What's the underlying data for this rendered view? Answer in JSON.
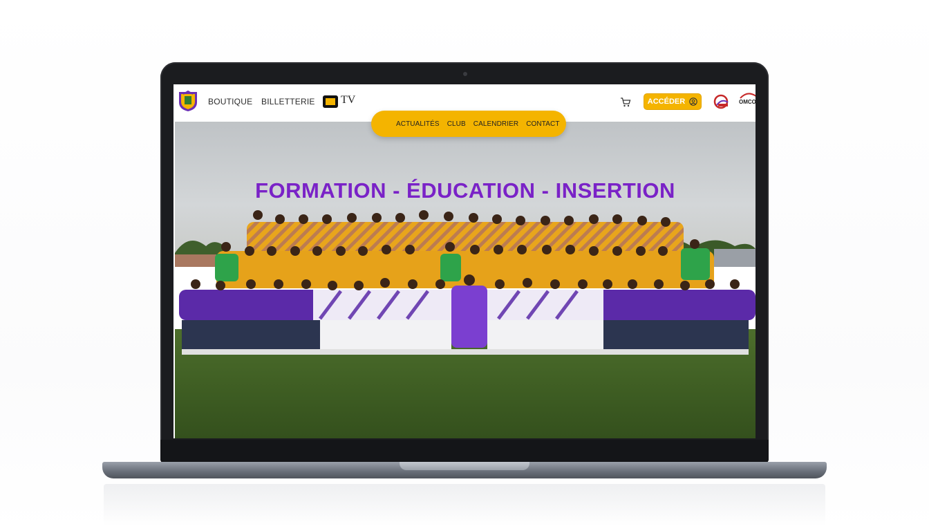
{
  "header": {
    "nav_left": [
      "BOUTIQUE",
      "BILLETTERIE"
    ],
    "tv_label": "TV",
    "cta_label": "ACCÉDER",
    "sponsor_text": "OMCO"
  },
  "pill_nav": {
    "items": [
      "ACTUALITÉS",
      "CLUB",
      "CALENDRIER",
      "CONTACT"
    ]
  },
  "hero": {
    "headline": "FORMATION - ÉDUCATION - INSERTION"
  },
  "icons": [
    "club-crest-icon",
    "tv-logo-icon",
    "cart-icon",
    "user-icon",
    "grid-menu-icon",
    "sponsor-logo-icon"
  ],
  "colors": {
    "accent_yellow": "#f4b400",
    "headline_purple": "#7a22c7",
    "jersey_yellow": "#e8a51c",
    "jersey_purple": "#5b2aa8",
    "keeper_green": "#2ea34a"
  }
}
